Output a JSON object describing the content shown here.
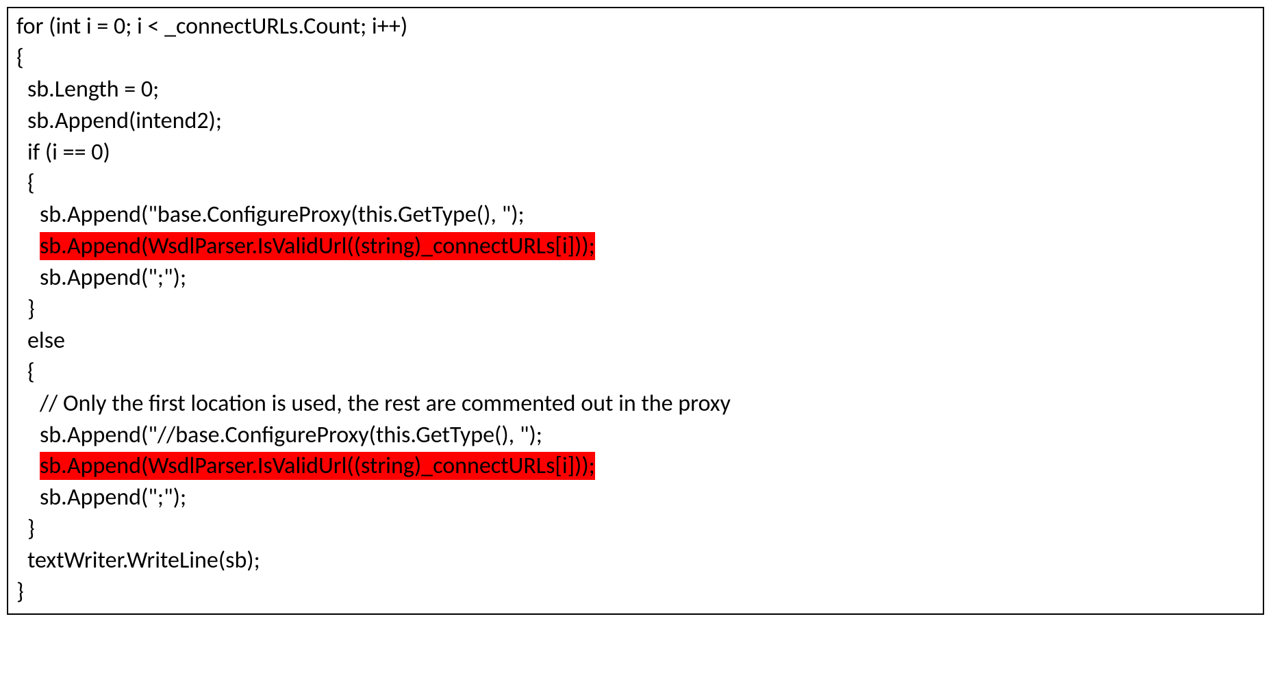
{
  "code": {
    "l1": "for (int i = 0; i < _connectURLs.Count; i++)",
    "l2": "{",
    "l3": "sb.Length = 0;",
    "l4": "sb.Append(intend2);",
    "l5": "if (i == 0)",
    "l6": "{",
    "l7": "sb.Append(\"base.ConfigureProxy(this.GetType(), \");",
    "l8": "sb.Append(WsdlParser.IsValidUrl((string)_connectURLs[i]));",
    "l9": "sb.Append(\";\");",
    "l10": "}",
    "l11": "else",
    "l12": "{",
    "l13": "// Only the first location is used, the rest are commented out in the proxy",
    "l14": "sb.Append(\"//base.ConfigureProxy(this.GetType(), \");",
    "l15": "sb.Append(WsdlParser.IsValidUrl((string)_connectURLs[i]));",
    "l16": "sb.Append(\";\");",
    "l17": "}",
    "l18": "textWriter.WriteLine(sb);",
    "l19": "}"
  }
}
